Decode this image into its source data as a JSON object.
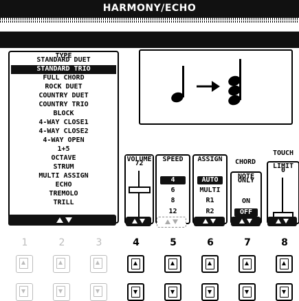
{
  "screen": {
    "title": "HARMONY/ECHO"
  },
  "type_list": {
    "label": "TYPE",
    "items": [
      "STANDARD DUET",
      "STANDARD TRIO",
      "FULL CHORD",
      "ROCK DUET",
      "COUNTRY DUET",
      "COUNTRY TRIO",
      "BLOCK",
      "4-WAY CLOSE1",
      "4-WAY CLOSE2",
      "4-WAY OPEN",
      "1+5",
      "OCTAVE",
      "STRUM",
      "MULTI ASSIGN",
      "ECHO",
      "TREMOLO",
      "TRILL"
    ],
    "selected": "STANDARD TRIO"
  },
  "preview": {
    "icon": "note-to-chord-icon"
  },
  "params": {
    "volume": {
      "label": "VOLUME",
      "value": "72"
    },
    "speed": {
      "label": "SPEED",
      "options": [
        "4",
        "6",
        "8",
        "12"
      ],
      "selected": "4"
    },
    "assign": {
      "label": "ASSIGN",
      "options": [
        "AUTO",
        "MULTI",
        "R1",
        "R2"
      ],
      "selected": "AUTO"
    },
    "chord_note_only": {
      "label_line1": "CHORD",
      "label_line2": "NOTE",
      "label_line3": "ONLY",
      "options": [
        "ON",
        "OFF"
      ],
      "selected": "OFF"
    },
    "touch_limit": {
      "label_line1": "TOUCH",
      "label_line2": "LIMIT",
      "value": "0"
    }
  },
  "panel_buttons": {
    "numbers": [
      "1",
      "2",
      "3",
      "4",
      "5",
      "6",
      "7",
      "8"
    ]
  },
  "colors": {
    "lcd_dark": "#111111",
    "disabled": "#bbbbbb"
  }
}
